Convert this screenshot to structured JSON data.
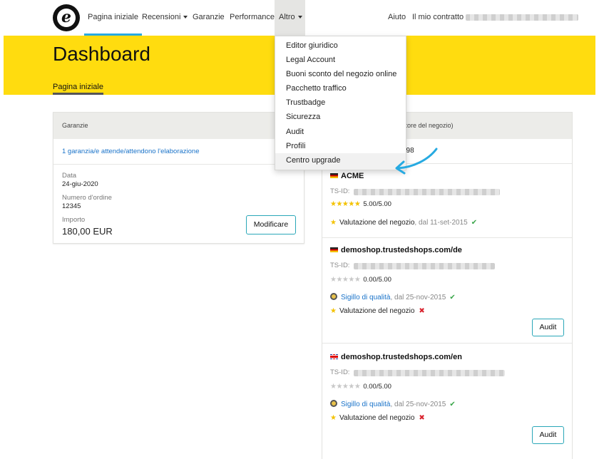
{
  "nav": {
    "home": "Pagina iniziale",
    "recensioni": "Recensioni",
    "garanzie": "Garanzie",
    "performance": "Performance",
    "altro": "Altro",
    "aiuto": "Aiuto",
    "contratto": "Il mio contratto"
  },
  "header": {
    "title": "Dashboard",
    "subtab": "Pagina iniziale"
  },
  "guarantees_card": {
    "title": "Garanzie",
    "pending_link": "1 garanzia/e attende/attendono l'elaborazione",
    "date_label": "Data",
    "date_value": "24-giu-2020",
    "order_label": "Numero d'ordine",
    "order_value": "12345",
    "amount_label": "Importo",
    "amount_value": "180,00 EUR",
    "edit_button": "Modificare"
  },
  "shops_card": {
    "title_fragment": "store del negozio)",
    "count_fragment": "998",
    "shops": [
      {
        "flag": "de",
        "name": "ACME",
        "tsid_label": "TS-ID:",
        "stars_filled": 5,
        "score": "5.00/5.00",
        "review_label": "Valutazione del negozio",
        "review_date": ", dal 11-set-2015"
      },
      {
        "flag": "de",
        "name": "demoshop.trustedshops.com/de",
        "tsid_label": "TS-ID:",
        "stars_filled": 0,
        "score": "0.00/5.00",
        "seal_label": "Sigillo di qualità",
        "seal_date": ", dal 25-nov-2015",
        "review_label": "Valutazione del negozio",
        "audit_button": "Audit"
      },
      {
        "flag": "uk",
        "name": "demoshop.trustedshops.com/en",
        "tsid_label": "TS-ID:",
        "stars_filled": 0,
        "score": "0.00/5.00",
        "seal_label": "Sigillo di qualità",
        "seal_date": ", dal 25-nov-2015",
        "review_label": "Valutazione del negozio",
        "audit_button": "Audit"
      }
    ]
  },
  "altro_menu": {
    "items": [
      "Editor giuridico",
      "Legal Account",
      "Buoni sconto del negozio online",
      "Pacchetto traffico",
      "Trustbadge",
      "Sicurezza",
      "Audit",
      "Profili",
      "Centro upgrade"
    ],
    "highlighted": "Centro upgrade"
  },
  "colors": {
    "brand_yellow": "#ffdc0f",
    "accent_blue": "#27aae1",
    "link_blue": "#1a73c9",
    "button_border": "#2aa7b8",
    "annotation_arrow": "#27aae1"
  }
}
